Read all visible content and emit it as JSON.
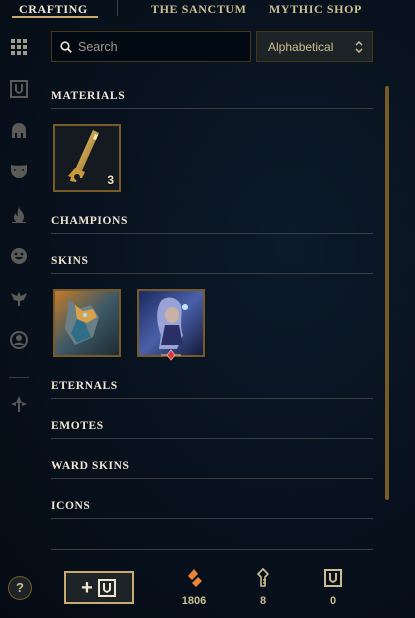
{
  "nav": {
    "tabs": [
      {
        "label": "CRAFTING",
        "active": true
      },
      {
        "label": "THE SANCTUM",
        "active": false
      },
      {
        "label": "MYTHIC SHOP",
        "active": false
      }
    ]
  },
  "sidebar": {
    "icons": [
      "grid-icon",
      "shield-icon",
      "helmet-icon",
      "mask-icon",
      "flame-icon",
      "smiley-icon",
      "ward-icon",
      "profile-icon",
      "arrow-icon"
    ]
  },
  "search": {
    "placeholder": "Search",
    "value": ""
  },
  "sort": {
    "selected": "Alphabetical"
  },
  "sections": {
    "materials": "MATERIALS",
    "champions": "CHAMPIONS",
    "skins": "SKINS",
    "eternals": "ETERNALS",
    "emotes": "EMOTES",
    "ward_skins": "WARD SKINS",
    "icons": "ICONS"
  },
  "materials": [
    {
      "name": "hextech key fragment",
      "qty": "3"
    }
  ],
  "skins": [
    {
      "name": "armored champion skin"
    },
    {
      "name": "mage champion skin"
    }
  ],
  "footer": {
    "help": "?",
    "add_label": "+",
    "currencies": [
      {
        "name": "orange-essence-icon",
        "value": "1806",
        "color": "#e8843b"
      },
      {
        "name": "key-icon",
        "value": "8",
        "color": "#cdbe91"
      },
      {
        "name": "chest-icon",
        "value": "0",
        "color": "#cdbe91"
      }
    ]
  },
  "colors": {
    "gold": "#c8aa6e",
    "dark_gold": "#785a28",
    "text_light": "#f0e6d2",
    "text_gold": "#cdbe91"
  }
}
